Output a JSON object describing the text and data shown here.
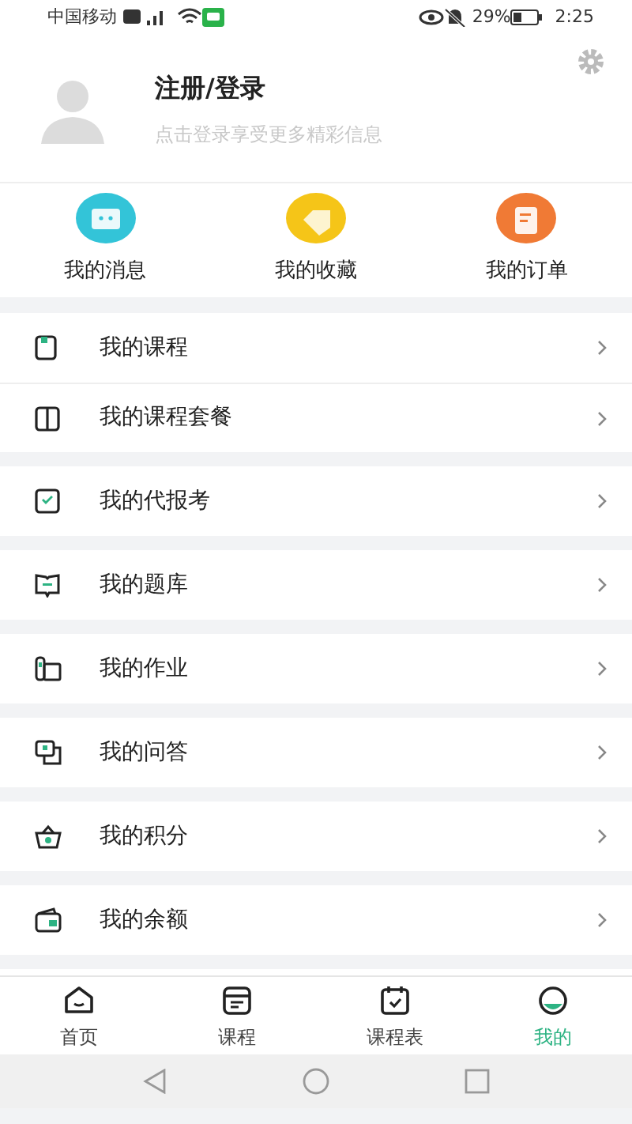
{
  "status_bar": {
    "carrier": "中国移动",
    "battery": "29%",
    "time": "2:25"
  },
  "profile": {
    "title": "注册/登录",
    "subtitle": "点击登录享受更多精彩信息"
  },
  "quick_links": [
    {
      "label": "我的消息",
      "color": "#33c4d8"
    },
    {
      "label": "我的收藏",
      "color": "#f5c518"
    },
    {
      "label": "我的订单",
      "color": "#f07a35"
    }
  ],
  "menu_groups": [
    {
      "items": [
        {
          "label": "我的课程"
        },
        {
          "label": "我的课程套餐"
        }
      ]
    },
    {
      "items": [
        {
          "label": "我的代报考"
        }
      ]
    },
    {
      "items": [
        {
          "label": "我的题库"
        }
      ]
    },
    {
      "items": [
        {
          "label": "我的作业"
        }
      ]
    },
    {
      "items": [
        {
          "label": "我的问答"
        }
      ]
    },
    {
      "items": [
        {
          "label": "我的积分"
        }
      ]
    },
    {
      "items": [
        {
          "label": "我的余额"
        }
      ]
    }
  ],
  "tabs": [
    {
      "label": "首页",
      "selected": false
    },
    {
      "label": "课程",
      "selected": false
    },
    {
      "label": "课程表",
      "selected": false
    },
    {
      "label": "我的",
      "selected": true
    }
  ]
}
